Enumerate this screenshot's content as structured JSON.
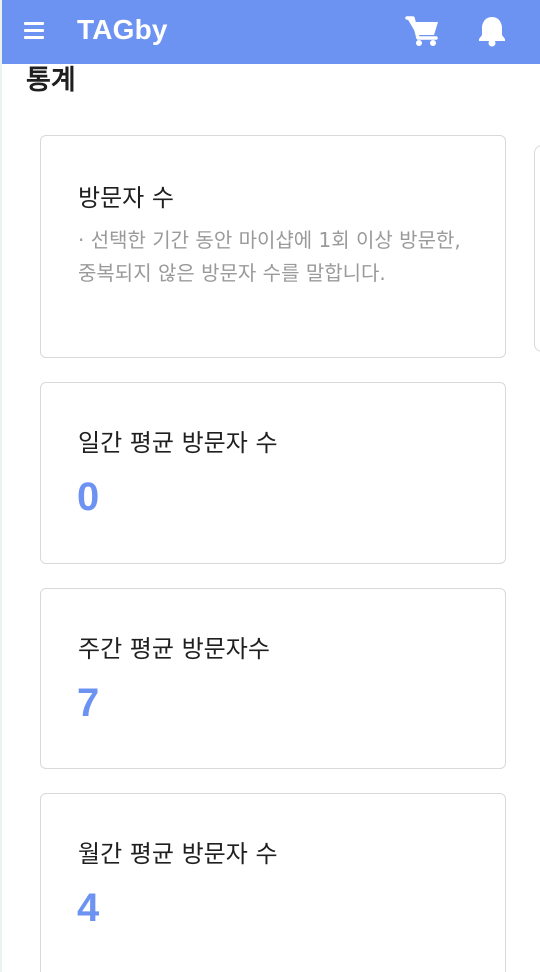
{
  "appbar": {
    "title": "TAGby",
    "icons": {
      "menu": "hamburger-menu-icon",
      "cart": "shopping-cart-icon",
      "notifications": "bell-icon"
    }
  },
  "section": {
    "title": "통계"
  },
  "cards": {
    "info": {
      "title": "방문자 수",
      "description": "· 선택한 기간 동안 마이샵에 1회 이상 방문한, 중복되지 않은 방문자 수를 말합니다."
    },
    "daily": {
      "label": "일간 평균 방문자 수",
      "value": "0"
    },
    "weekly": {
      "label": "주간 평균 방문자수",
      "value": "7"
    },
    "monthly": {
      "label": "월간 평균 방문자 수",
      "value": "4"
    }
  },
  "colors": {
    "brand": "#6c93f2",
    "text": "#1f1f1f",
    "muted": "#9a9a9a",
    "border": "#d9d9d9"
  }
}
